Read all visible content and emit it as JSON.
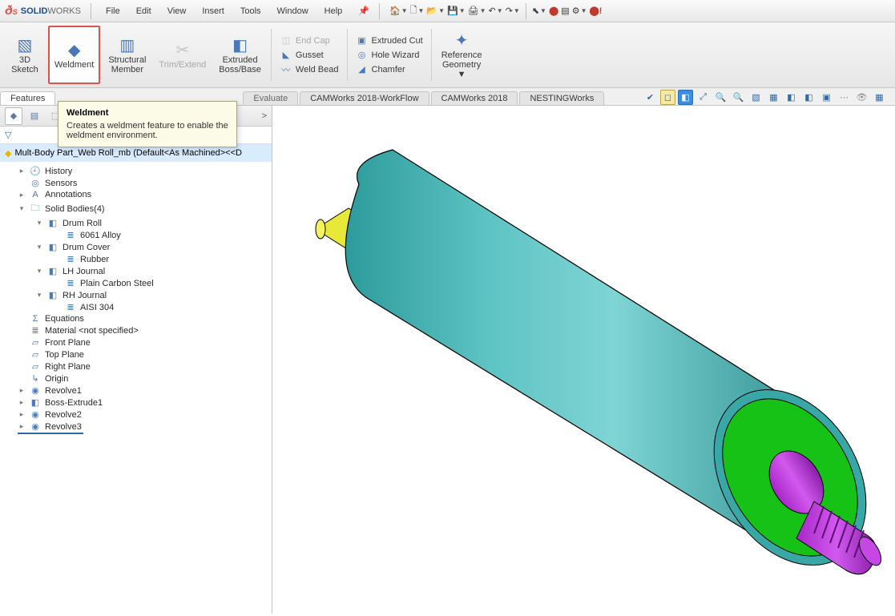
{
  "app": {
    "brand_bold": "SOLID",
    "brand_light": "WORKS"
  },
  "menu": [
    "File",
    "Edit",
    "View",
    "Insert",
    "Tools",
    "Window",
    "Help"
  ],
  "ribbon": {
    "sketch3d": "3D\nSketch",
    "weldment": "Weldment",
    "structural": "Structural\nMember",
    "trimextend": "Trim/Extend",
    "extruded": "Extruded\nBoss/Base",
    "endcap": "End Cap",
    "gusset": "Gusset",
    "weldbead": "Weld Bead",
    "extcut": "Extruded Cut",
    "holewiz": "Hole Wizard",
    "chamfer": "Chamfer",
    "refgeom": "Reference\nGeometry"
  },
  "tabs": {
    "features": "Features",
    "evaluate": "Evaluate",
    "cw_wf": "CAMWorks 2018-WorkFlow",
    "cw": "CAMWorks 2018",
    "nest": "NESTINGWorks"
  },
  "tooltip": {
    "title": "Weldment",
    "body": "Creates a weldment feature to enable the weldment environment."
  },
  "tree": {
    "root": "Mult-Body Part_Web Roll_mb  (Default<As Machined><<D",
    "history": "History",
    "sensors": "Sensors",
    "annotations": "Annotations",
    "solidbodies": "Solid Bodies(4)",
    "drumroll": "Drum Roll",
    "drumroll_mat": "6061 Alloy",
    "drumcover": "Drum Cover",
    "drumcover_mat": "Rubber",
    "lhj": "LH Journal",
    "lhj_mat": "Plain Carbon Steel",
    "rhj": "RH Journal",
    "rhj_mat": "AISI 304",
    "equations": "Equations",
    "material": "Material <not specified>",
    "frontplane": "Front Plane",
    "topplane": "Top Plane",
    "rightplane": "Right Plane",
    "origin": "Origin",
    "rev1": "Revolve1",
    "bossext1": "Boss-Extrude1",
    "rev2": "Revolve2",
    "rev3": "Revolve3"
  }
}
